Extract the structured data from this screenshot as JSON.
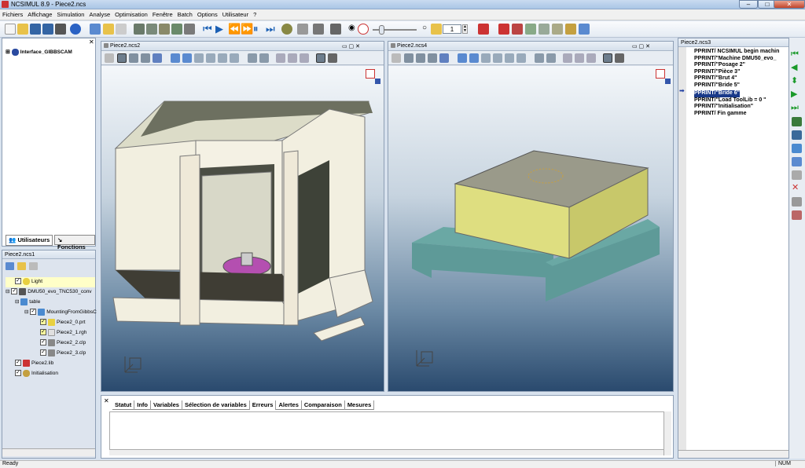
{
  "app": {
    "title": "NCSIMUL 8.9 - Piece2.ncs",
    "status": "Ready",
    "num": "NUM"
  },
  "window_buttons": {
    "minimize": "–",
    "maximize": "□",
    "close": "✕"
  },
  "menu": [
    "Fichiers",
    "Affichage",
    "Simulation",
    "Analyse",
    "Optimisation",
    "Fenêtre",
    "Batch",
    "Options",
    "Utilisateur",
    "?"
  ],
  "toolbar": {
    "step_value": "1"
  },
  "left_panel": {
    "root_item": "Interface_GIBBSCAM",
    "tabs": [
      "Utilisateurs",
      "Fonctions"
    ]
  },
  "tree_panel": {
    "title": "Piece2.ncs1",
    "items": [
      "Light",
      "DMU50_evo_TNC530_conv",
      "table",
      "MountingFromGibbsC",
      "Piece2_0.prt",
      "Piece2_1.rgh",
      "Piece2_2.clp",
      "Piece2_3.clp",
      "Piece2.lib",
      "Initialisation"
    ]
  },
  "viewports": [
    {
      "title": "Piece2.ncs2"
    },
    {
      "title": "Piece2.ncs4"
    }
  ],
  "bottom_tabs": [
    "Statut",
    "Info",
    "Variables",
    "Sélection de variables",
    "Erreurs",
    "Alertes",
    "Comparaison",
    "Mesures"
  ],
  "right_panel": {
    "title": "Piece2.ncs3",
    "lines": [
      "PPRINT/ NCSIMUL begin machin",
      "PPRINT/\"Machine DMU50_evo_",
      "PPRINT/\"Posage 2\"",
      "PPRINT/\"Pièce 3\"",
      "PPRINT/\"Brut 4\"",
      "PPRINT/\"Bride 5\"",
      "PPRINT/\"Bride 6\"",
      "PPRINT/\"Load ToolLib = 0 \"",
      "PPRINT/\"Initialisation\"",
      "PPRINT/ Fin gamme"
    ],
    "current_line": "PPRINT/\"Bride 6\""
  },
  "colors": {
    "accent": "#1a5fb4",
    "part_top": "#9a9a8a",
    "part_side": "#dede80",
    "fixture": "#5e9a98",
    "machine": "#f2efe0"
  }
}
